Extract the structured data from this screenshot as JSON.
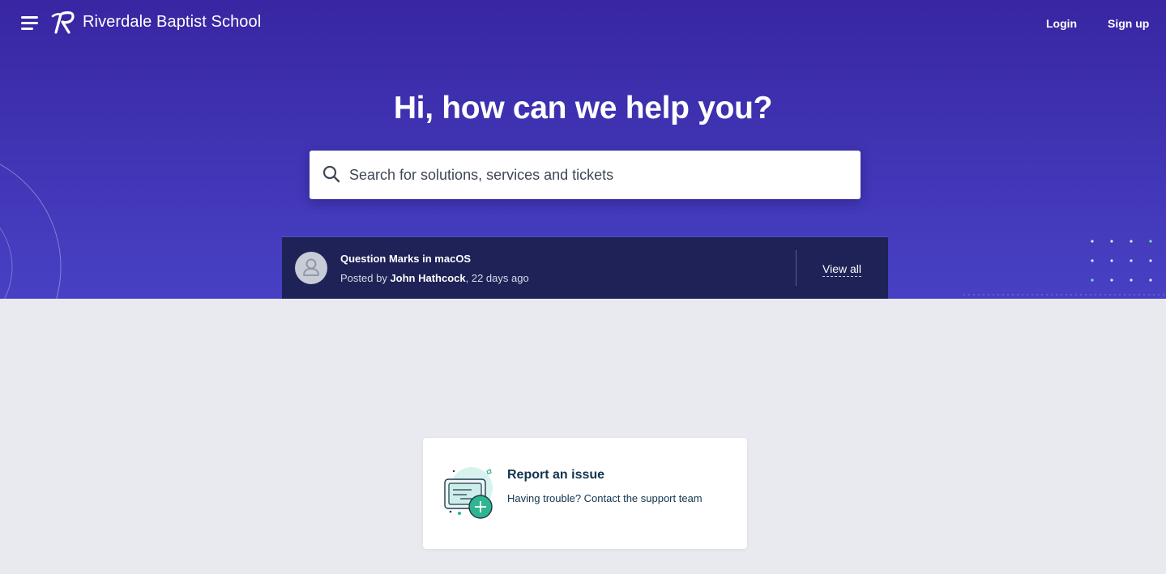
{
  "header": {
    "menu_icon": "hamburger-menu-icon",
    "logo_icon": "riverdale-r-logo-icon",
    "brand_name": "Riverdale Baptist School",
    "login_label": "Login",
    "signup_label": "Sign up"
  },
  "hero": {
    "headline": "Hi, how can we help you?",
    "search": {
      "placeholder": "Search for solutions, services and tickets",
      "value": "",
      "icon": "search-icon"
    }
  },
  "announcement": {
    "title": "Question Marks in macOS",
    "posted_by_prefix": "Posted by ",
    "author": "John Hathcock",
    "time_suffix": ", 22 days ago",
    "view_all_label": "View all",
    "avatar_icon": "user-avatar-icon"
  },
  "cards": {
    "report": {
      "title": "Report an issue",
      "description": "Having trouble? Contact the support team",
      "icon": "ticket-add-icon"
    }
  },
  "colors": {
    "hero_top": "#3826a2",
    "hero_bottom": "#4840c4",
    "announce_bg": "#1e2256",
    "page_bg": "#e8eaf0",
    "card_title": "#12344d",
    "accent_green": "#2fb58f"
  }
}
